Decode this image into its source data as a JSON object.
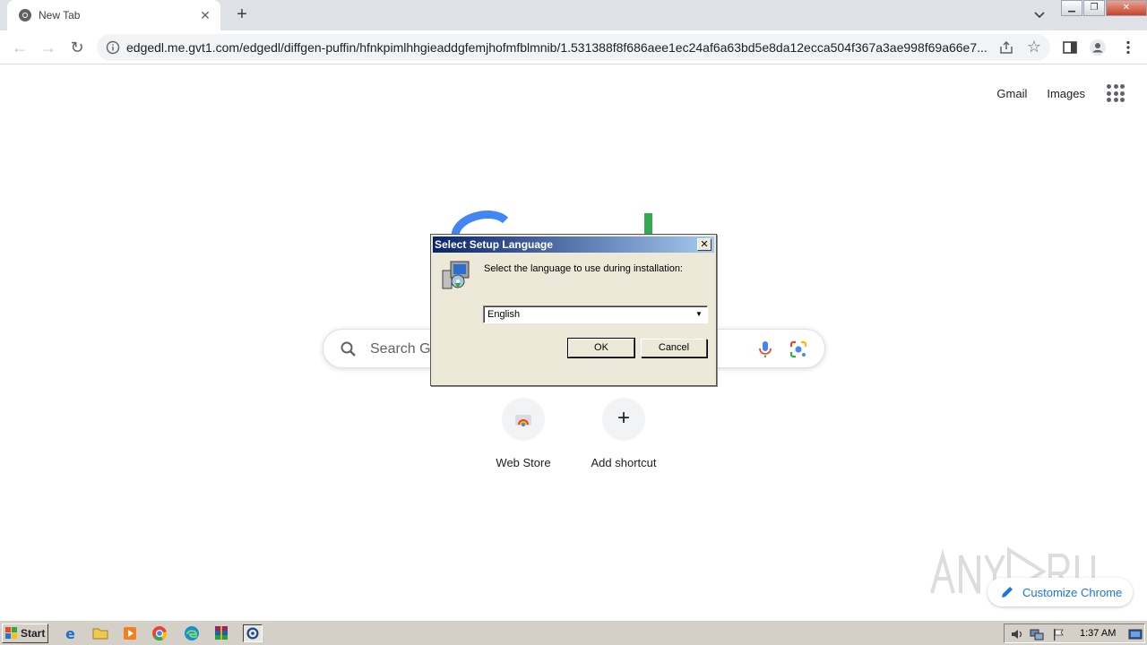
{
  "browser": {
    "tab_title": "New Tab",
    "url": "edgedl.me.gvt1.com/edgedl/diffgen-puffin/hfnkpimlhhgieaddgfemjhofmfblmnib/1.531388f8f686aee1ec24af6a63bd5e8da12ecca504f367a3ae998f69a66e7..."
  },
  "page": {
    "gmail": "Gmail",
    "images": "Images",
    "search_placeholder": "Search Go",
    "shortcuts": [
      {
        "label": "Web Store"
      },
      {
        "label": "Add shortcut"
      }
    ],
    "customize_label": "Customize Chrome"
  },
  "dialog": {
    "title": "Select Setup Language",
    "prompt": "Select the language to use during installation:",
    "selected_language": "English",
    "ok_label": "OK",
    "cancel_label": "Cancel"
  },
  "taskbar": {
    "start_label": "Start",
    "clock": "1:37 AM"
  },
  "icons": [
    "chrome-icon",
    "search-icon",
    "mic-icon",
    "lens-icon",
    "apps-icon",
    "installer-icon"
  ],
  "colors": {
    "link_blue": "#1a73e8",
    "dialog_title_start": "#0a246a",
    "taskbar": "#d4d0c8"
  }
}
